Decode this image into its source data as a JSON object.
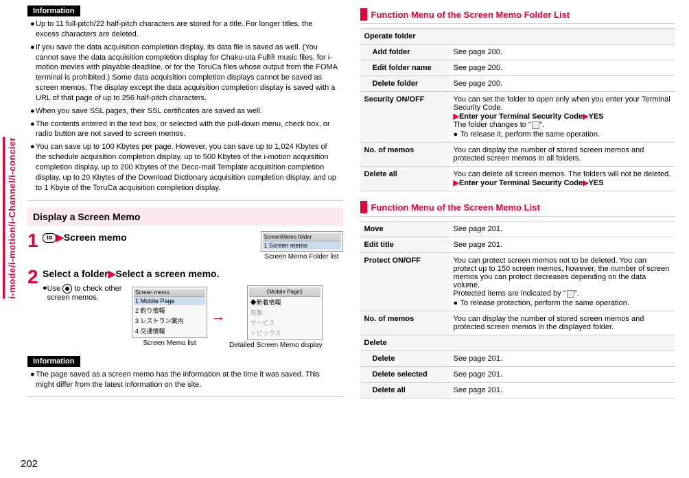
{
  "sideTab": "i-mode/i-motion/i-Channel/i-concier",
  "pageNumber": "202",
  "left": {
    "info1": {
      "label": "Information",
      "bullets": [
        "Up to 11 full-pitch/22 half-pitch characters are stored for a title. For longer titles, the excess characters are deleted.",
        "If you save the data acquisition completion display, its data file is saved as well. (You cannot save the data acquisition completion display for Chaku-uta Full® music files, for i-motion movies with playable deadline, or for the ToruCa files whose output from the FOMA terminal is prohibited.) Some data acquisition completion displays cannot be saved as screen memos. The display except the data acquisition completion display is saved with a URL of that page of up to 256 half-pitch characters.",
        "When you save SSL pages, their SSL certificates are saved as well.",
        "The contents entered in the text box, or selected with the pull-down menu, check box, or radio button are not saved to screen memos.",
        "You can save up to 100 Kbytes per page. However, you can save up to 1,024 Kbytes of the schedule acquisition completion display, up to 500 Kbytes of the i-motion acquisition completion display, up to 200 Kbytes of the Deco-mail Template acquisition completion display, up to 20 Kbytes of the Download Dictionary acquisition completion display, and up to 1 Kbyte of the ToruCa acquisition completion display."
      ]
    },
    "sectionHeading": "Display a Screen Memo",
    "step1": {
      "title": "Screen memo",
      "keyIcon": "iα"
    },
    "folderShot": {
      "title": "ScreenMemo folder",
      "line": "1 Screen memo",
      "caption": "Screen Memo Folder list"
    },
    "step2": {
      "titleA": "Select a folder",
      "titleB": "Select a screen memo.",
      "note": "to check other screen memos.",
      "notePrefix": "Use"
    },
    "listShot": {
      "title": "Screen memo",
      "l1": "1 Mobile Page",
      "l2": "2 釣り情報",
      "l3": "3 レストラン案内",
      "l4": "4 交通情報",
      "caption": "Screen Memo list"
    },
    "detailShot": {
      "title": "《Mobile Page》",
      "l1": "◆新着情報",
      "l2": "気象",
      "l3": "サービス",
      "l4": "トピックス",
      "caption": "Detailed Screen Memo display"
    },
    "info2": {
      "label": "Information",
      "bullets": [
        "The page saved as a screen memo has the information at the time it was saved. This might differ from the latest information on the site."
      ]
    }
  },
  "right": {
    "fn1": {
      "heading": "Function Menu of the Screen Memo Folder List",
      "groupOperate": "Operate folder",
      "rows": {
        "addFolder": {
          "k": "Add folder",
          "v": "See page 200."
        },
        "editFolder": {
          "k": "Edit folder name",
          "v": "See page 200."
        },
        "deleteFolder": {
          "k": "Delete folder",
          "v": "See page 200."
        },
        "security": {
          "k": "Security ON/OFF",
          "v1": "You can set the folder to open only when you enter your Terminal Security Code.",
          "v2a": "Enter your Terminal Security Code",
          "v2b": "YES",
          "v3": "The folder changes to \"    \".",
          "v4": "To release it, perform the same operation."
        },
        "noMemos": {
          "k": "No. of memos",
          "v": "You can display the number of stored screen memos and protected screen memos in all folders."
        },
        "deleteAll": {
          "k": "Delete all",
          "v1": "You can delete all screen memos. The folders will not be deleted.",
          "v2a": "Enter your Terminal Security Code",
          "v2b": "YES"
        }
      }
    },
    "fn2": {
      "heading": "Function Menu of the Screen Memo List",
      "rows": {
        "move": {
          "k": "Move",
          "v": "See page 201."
        },
        "editTitle": {
          "k": "Edit title",
          "v": "See page 201."
        },
        "protect": {
          "k": "Protect ON/OFF",
          "v1": "You can protect screen memos not to be deleted. You can protect up to 150 screen memos, however, the number of screen memos you can protect decreases depending on the data volume.",
          "v2": "Protected items are indicated by \"    \".",
          "v3": "To release protection, perform the same operation."
        },
        "noMemos": {
          "k": "No. of memos",
          "v": "You can display the number of stored screen memos and protected screen memos in the displayed folder."
        },
        "deleteGrp": "Delete",
        "delete": {
          "k": "Delete",
          "v": "See page 201."
        },
        "deleteSel": {
          "k": "Delete selected",
          "v": "See page 201."
        },
        "deleteAll": {
          "k": "Delete all",
          "v": "See page 201."
        }
      }
    }
  }
}
